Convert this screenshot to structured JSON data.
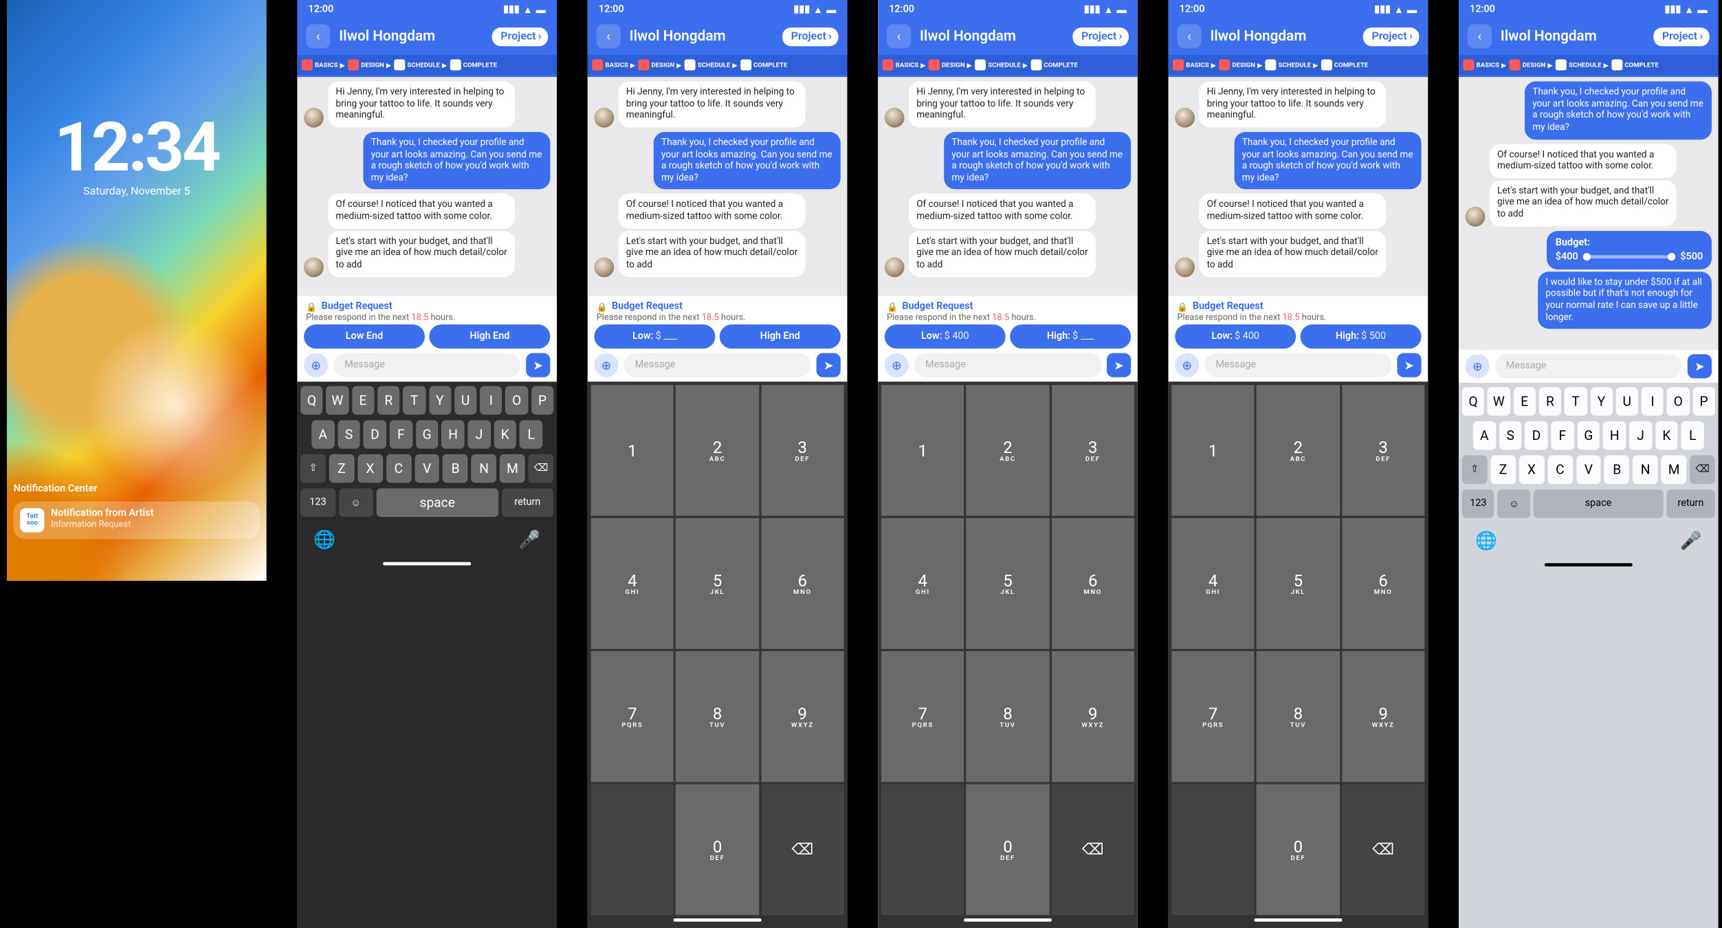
{
  "status": {
    "time": "12:00"
  },
  "lock": {
    "time": "12:34",
    "date": "Saturday, November 5",
    "nc_label": "Notification Center",
    "notif_app": "Tatt\nooo",
    "notif_title": "Notification from Artist",
    "notif_sub": "Information Request"
  },
  "header": {
    "title": "Ilwol Hongdam",
    "project": "Project",
    "pills": [
      "BASICS",
      "DESIGN",
      "SCHEDULE",
      "COMPLETE"
    ]
  },
  "messages": {
    "m1": "Hi Jenny, I'm very interested in helping to bring your tattoo to life. It sounds very meaningful.",
    "m2": "Thank you, I checked your profile and your art looks amazing. Can you send me a rough sketch of how you'd work with my idea?",
    "m3": "Of course! I noticed that you wanted a medium-sized tattoo with some color.",
    "m4a": "Let's start with your budget, and that'll give me an idea of how much detail/color to add",
    "m4b": "Let's start with your budget, and that'll give me an idea of how much detail/color to add",
    "m5": "I would like to stay under $500 if at all possible but if that's not enough for your normal rate I can save up a little longer."
  },
  "budget": {
    "title": "Budget Request",
    "sub_a": "Please respond in the next ",
    "sub_b": "18.5",
    "sub_c": " hours.",
    "low": "Low End",
    "high": "High End",
    "low_pfx": "Low:",
    "high_pfx": "High:",
    "dollar_blank": "$ ___",
    "v400": "$ 400",
    "v500": "$ 500",
    "panel_title": "Budget:",
    "panel_low": "$400",
    "panel_high": "$500"
  },
  "input": {
    "placeholder": "Message"
  },
  "qwerty": {
    "r1": [
      "Q",
      "W",
      "E",
      "R",
      "T",
      "Y",
      "U",
      "I",
      "O",
      "P"
    ],
    "r2": [
      "A",
      "S",
      "D",
      "F",
      "G",
      "H",
      "J",
      "K",
      "L"
    ],
    "r3": [
      "Z",
      "X",
      "C",
      "V",
      "B",
      "N",
      "M"
    ],
    "nums": "123",
    "space": "space",
    "ret": "return"
  },
  "numpad": {
    "1": "1",
    "2": "2",
    "3": "3",
    "4": "4",
    "5": "5",
    "6": "6",
    "7": "7",
    "8": "8",
    "9": "9",
    "0": "0",
    "s2": "ABC",
    "s3": "DEF",
    "s4": "GHI",
    "s5": "JKL",
    "s6": "MNO",
    "s7": "PQRS",
    "s8": "TUV",
    "s9": "WXYZ",
    "s0": "DEF"
  }
}
